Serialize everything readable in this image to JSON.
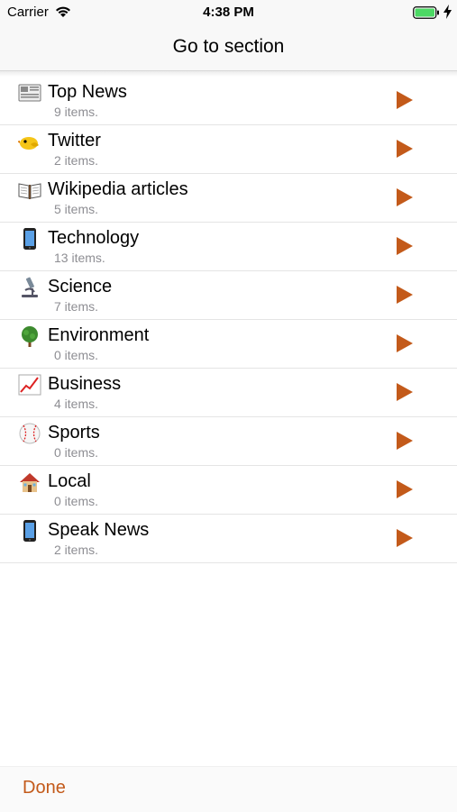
{
  "status_bar": {
    "carrier": "Carrier",
    "time": "4:38 PM"
  },
  "nav": {
    "title": "Go to section"
  },
  "accent_color": "#c35a1a",
  "sections": [
    {
      "title": "Top News",
      "count": "9 items.",
      "icon": "newspaper-icon"
    },
    {
      "title": "Twitter",
      "count": "2 items.",
      "icon": "bird-icon"
    },
    {
      "title": "Wikipedia articles",
      "count": "5 items.",
      "icon": "open-book-icon"
    },
    {
      "title": "Technology",
      "count": "13 items.",
      "icon": "smartphone-icon"
    },
    {
      "title": "Science",
      "count": "7 items.",
      "icon": "microscope-icon"
    },
    {
      "title": "Environment",
      "count": "0 items.",
      "icon": "tree-icon"
    },
    {
      "title": "Business",
      "count": "4 items.",
      "icon": "chart-increasing-icon"
    },
    {
      "title": "Sports",
      "count": "0 items.",
      "icon": "baseball-icon"
    },
    {
      "title": "Local",
      "count": "0 items.",
      "icon": "house-icon"
    },
    {
      "title": "Speak News",
      "count": "2 items.",
      "icon": "smartphone-icon"
    }
  ],
  "toolbar": {
    "done_label": "Done"
  }
}
